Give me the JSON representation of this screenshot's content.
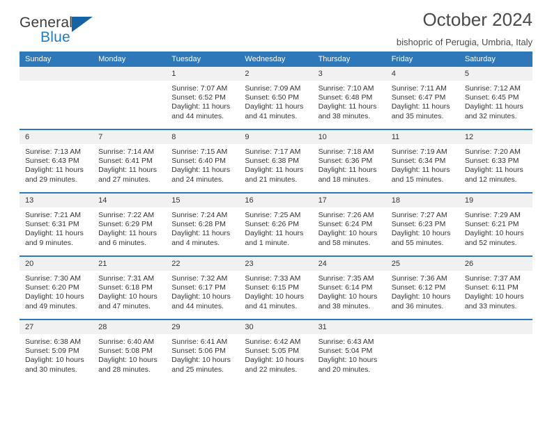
{
  "brand": {
    "name_top": "General",
    "name_bottom": "Blue",
    "accent_color": "#1f7bc4",
    "triangle_color": "#1464a5"
  },
  "header": {
    "title": "October 2024",
    "subtitle": "bishopric of Perugia, Umbria, Italy"
  },
  "calendar": {
    "header_color": "#2e77b8",
    "daynum_band_color": "#f1f1f1",
    "weekdays": [
      "Sunday",
      "Monday",
      "Tuesday",
      "Wednesday",
      "Thursday",
      "Friday",
      "Saturday"
    ],
    "weeks": [
      [
        {
          "day": "",
          "sunrise": "",
          "sunset": "",
          "daylight": "",
          "empty": true
        },
        {
          "day": "",
          "sunrise": "",
          "sunset": "",
          "daylight": "",
          "empty": true
        },
        {
          "day": "1",
          "sunrise": "Sunrise: 7:07 AM",
          "sunset": "Sunset: 6:52 PM",
          "daylight": "Daylight: 11 hours and 44 minutes."
        },
        {
          "day": "2",
          "sunrise": "Sunrise: 7:09 AM",
          "sunset": "Sunset: 6:50 PM",
          "daylight": "Daylight: 11 hours and 41 minutes."
        },
        {
          "day": "3",
          "sunrise": "Sunrise: 7:10 AM",
          "sunset": "Sunset: 6:48 PM",
          "daylight": "Daylight: 11 hours and 38 minutes."
        },
        {
          "day": "4",
          "sunrise": "Sunrise: 7:11 AM",
          "sunset": "Sunset: 6:47 PM",
          "daylight": "Daylight: 11 hours and 35 minutes."
        },
        {
          "day": "5",
          "sunrise": "Sunrise: 7:12 AM",
          "sunset": "Sunset: 6:45 PM",
          "daylight": "Daylight: 11 hours and 32 minutes."
        }
      ],
      [
        {
          "day": "6",
          "sunrise": "Sunrise: 7:13 AM",
          "sunset": "Sunset: 6:43 PM",
          "daylight": "Daylight: 11 hours and 29 minutes."
        },
        {
          "day": "7",
          "sunrise": "Sunrise: 7:14 AM",
          "sunset": "Sunset: 6:41 PM",
          "daylight": "Daylight: 11 hours and 27 minutes."
        },
        {
          "day": "8",
          "sunrise": "Sunrise: 7:15 AM",
          "sunset": "Sunset: 6:40 PM",
          "daylight": "Daylight: 11 hours and 24 minutes."
        },
        {
          "day": "9",
          "sunrise": "Sunrise: 7:17 AM",
          "sunset": "Sunset: 6:38 PM",
          "daylight": "Daylight: 11 hours and 21 minutes."
        },
        {
          "day": "10",
          "sunrise": "Sunrise: 7:18 AM",
          "sunset": "Sunset: 6:36 PM",
          "daylight": "Daylight: 11 hours and 18 minutes."
        },
        {
          "day": "11",
          "sunrise": "Sunrise: 7:19 AM",
          "sunset": "Sunset: 6:34 PM",
          "daylight": "Daylight: 11 hours and 15 minutes."
        },
        {
          "day": "12",
          "sunrise": "Sunrise: 7:20 AM",
          "sunset": "Sunset: 6:33 PM",
          "daylight": "Daylight: 11 hours and 12 minutes."
        }
      ],
      [
        {
          "day": "13",
          "sunrise": "Sunrise: 7:21 AM",
          "sunset": "Sunset: 6:31 PM",
          "daylight": "Daylight: 11 hours and 9 minutes."
        },
        {
          "day": "14",
          "sunrise": "Sunrise: 7:22 AM",
          "sunset": "Sunset: 6:29 PM",
          "daylight": "Daylight: 11 hours and 6 minutes."
        },
        {
          "day": "15",
          "sunrise": "Sunrise: 7:24 AM",
          "sunset": "Sunset: 6:28 PM",
          "daylight": "Daylight: 11 hours and 4 minutes."
        },
        {
          "day": "16",
          "sunrise": "Sunrise: 7:25 AM",
          "sunset": "Sunset: 6:26 PM",
          "daylight": "Daylight: 11 hours and 1 minute."
        },
        {
          "day": "17",
          "sunrise": "Sunrise: 7:26 AM",
          "sunset": "Sunset: 6:24 PM",
          "daylight": "Daylight: 10 hours and 58 minutes."
        },
        {
          "day": "18",
          "sunrise": "Sunrise: 7:27 AM",
          "sunset": "Sunset: 6:23 PM",
          "daylight": "Daylight: 10 hours and 55 minutes."
        },
        {
          "day": "19",
          "sunrise": "Sunrise: 7:29 AM",
          "sunset": "Sunset: 6:21 PM",
          "daylight": "Daylight: 10 hours and 52 minutes."
        }
      ],
      [
        {
          "day": "20",
          "sunrise": "Sunrise: 7:30 AM",
          "sunset": "Sunset: 6:20 PM",
          "daylight": "Daylight: 10 hours and 49 minutes."
        },
        {
          "day": "21",
          "sunrise": "Sunrise: 7:31 AM",
          "sunset": "Sunset: 6:18 PM",
          "daylight": "Daylight: 10 hours and 47 minutes."
        },
        {
          "day": "22",
          "sunrise": "Sunrise: 7:32 AM",
          "sunset": "Sunset: 6:17 PM",
          "daylight": "Daylight: 10 hours and 44 minutes."
        },
        {
          "day": "23",
          "sunrise": "Sunrise: 7:33 AM",
          "sunset": "Sunset: 6:15 PM",
          "daylight": "Daylight: 10 hours and 41 minutes."
        },
        {
          "day": "24",
          "sunrise": "Sunrise: 7:35 AM",
          "sunset": "Sunset: 6:14 PM",
          "daylight": "Daylight: 10 hours and 38 minutes."
        },
        {
          "day": "25",
          "sunrise": "Sunrise: 7:36 AM",
          "sunset": "Sunset: 6:12 PM",
          "daylight": "Daylight: 10 hours and 36 minutes."
        },
        {
          "day": "26",
          "sunrise": "Sunrise: 7:37 AM",
          "sunset": "Sunset: 6:11 PM",
          "daylight": "Daylight: 10 hours and 33 minutes."
        }
      ],
      [
        {
          "day": "27",
          "sunrise": "Sunrise: 6:38 AM",
          "sunset": "Sunset: 5:09 PM",
          "daylight": "Daylight: 10 hours and 30 minutes."
        },
        {
          "day": "28",
          "sunrise": "Sunrise: 6:40 AM",
          "sunset": "Sunset: 5:08 PM",
          "daylight": "Daylight: 10 hours and 28 minutes."
        },
        {
          "day": "29",
          "sunrise": "Sunrise: 6:41 AM",
          "sunset": "Sunset: 5:06 PM",
          "daylight": "Daylight: 10 hours and 25 minutes."
        },
        {
          "day": "30",
          "sunrise": "Sunrise: 6:42 AM",
          "sunset": "Sunset: 5:05 PM",
          "daylight": "Daylight: 10 hours and 22 minutes."
        },
        {
          "day": "31",
          "sunrise": "Sunrise: 6:43 AM",
          "sunset": "Sunset: 5:04 PM",
          "daylight": "Daylight: 10 hours and 20 minutes."
        },
        {
          "day": "",
          "sunrise": "",
          "sunset": "",
          "daylight": "",
          "empty": true
        },
        {
          "day": "",
          "sunrise": "",
          "sunset": "",
          "daylight": "",
          "empty": true
        }
      ]
    ]
  }
}
